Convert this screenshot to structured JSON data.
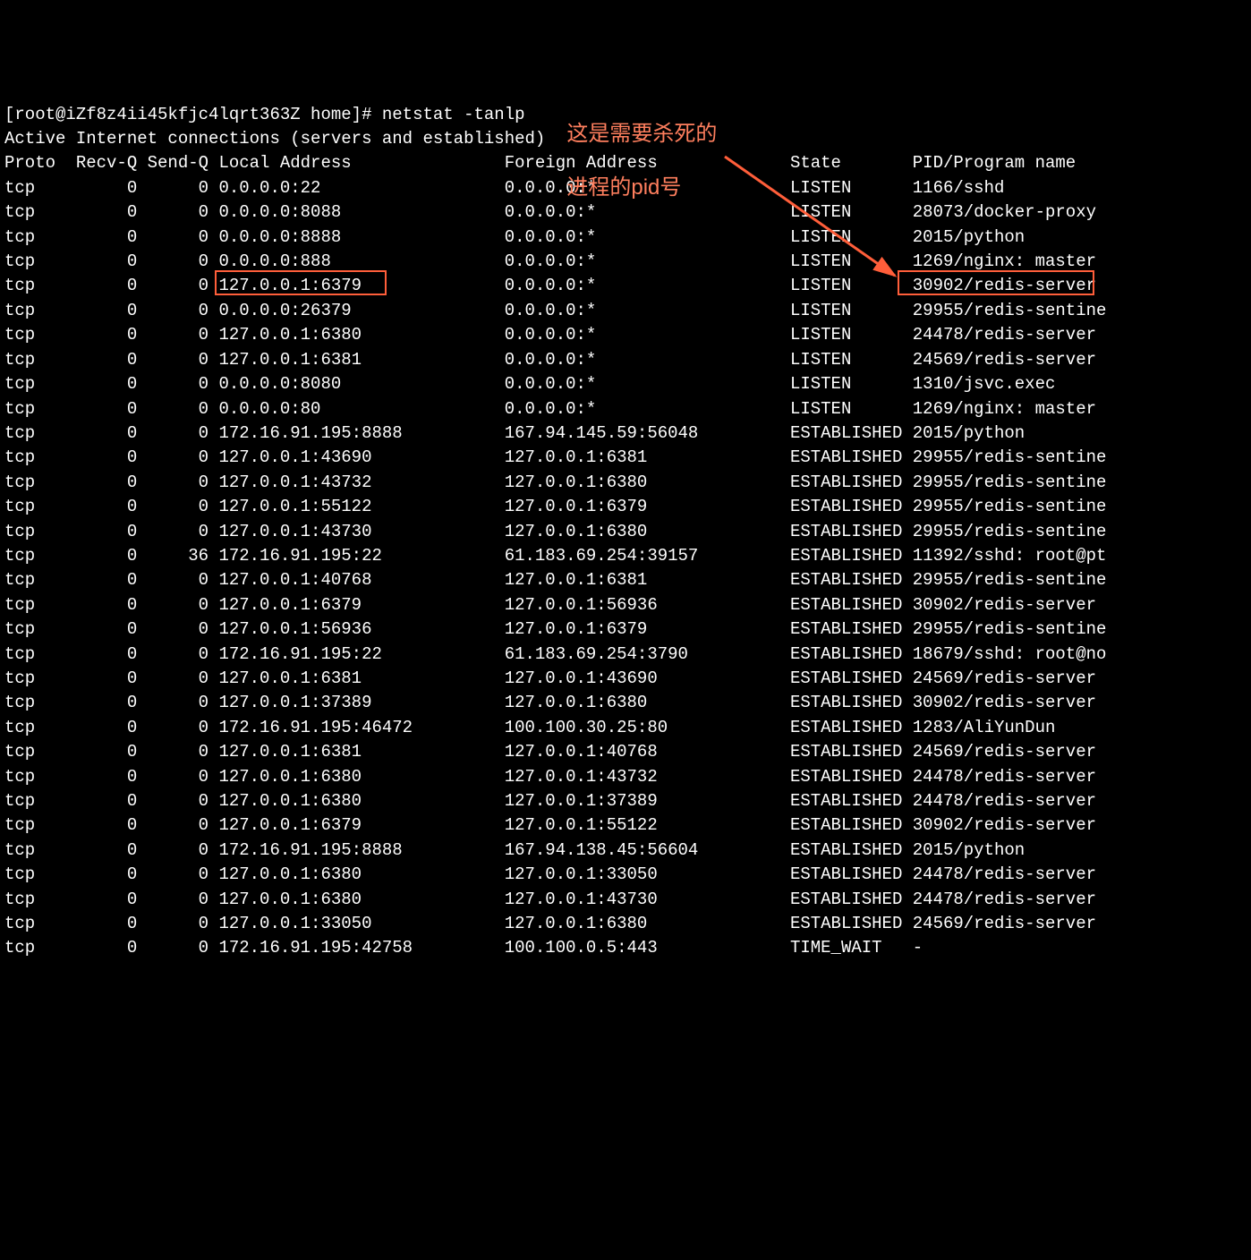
{
  "prompt": "[root@iZf8z4ii45kfjc4lqrt363Z home]# netstat -tanlp",
  "subtitle": "Active Internet connections (servers and established)",
  "header": [
    "Proto",
    "Recv-Q",
    "Send-Q",
    "Local Address",
    "Foreign Address",
    "State",
    "PID/Program name"
  ],
  "rows": [
    {
      "proto": "tcp",
      "recvq": "0",
      "sendq": "0",
      "local": "0.0.0.0:22",
      "foreign": "0.0.0.0:*",
      "state": "LISTEN",
      "pid": "1166/sshd"
    },
    {
      "proto": "tcp",
      "recvq": "0",
      "sendq": "0",
      "local": "0.0.0.0:8088",
      "foreign": "0.0.0.0:*",
      "state": "LISTEN",
      "pid": "28073/docker-proxy"
    },
    {
      "proto": "tcp",
      "recvq": "0",
      "sendq": "0",
      "local": "0.0.0.0:8888",
      "foreign": "0.0.0.0:*",
      "state": "LISTEN",
      "pid": "2015/python"
    },
    {
      "proto": "tcp",
      "recvq": "0",
      "sendq": "0",
      "local": "0.0.0.0:888",
      "foreign": "0.0.0.0:*",
      "state": "LISTEN",
      "pid": "1269/nginx: master"
    },
    {
      "proto": "tcp",
      "recvq": "0",
      "sendq": "0",
      "local": "127.0.0.1:6379",
      "foreign": "0.0.0.0:*",
      "state": "LISTEN",
      "pid": "30902/redis-server"
    },
    {
      "proto": "tcp",
      "recvq": "0",
      "sendq": "0",
      "local": "0.0.0.0:26379",
      "foreign": "0.0.0.0:*",
      "state": "LISTEN",
      "pid": "29955/redis-sentine"
    },
    {
      "proto": "tcp",
      "recvq": "0",
      "sendq": "0",
      "local": "127.0.0.1:6380",
      "foreign": "0.0.0.0:*",
      "state": "LISTEN",
      "pid": "24478/redis-server"
    },
    {
      "proto": "tcp",
      "recvq": "0",
      "sendq": "0",
      "local": "127.0.0.1:6381",
      "foreign": "0.0.0.0:*",
      "state": "LISTEN",
      "pid": "24569/redis-server"
    },
    {
      "proto": "tcp",
      "recvq": "0",
      "sendq": "0",
      "local": "0.0.0.0:8080",
      "foreign": "0.0.0.0:*",
      "state": "LISTEN",
      "pid": "1310/jsvc.exec"
    },
    {
      "proto": "tcp",
      "recvq": "0",
      "sendq": "0",
      "local": "0.0.0.0:80",
      "foreign": "0.0.0.0:*",
      "state": "LISTEN",
      "pid": "1269/nginx: master"
    },
    {
      "proto": "tcp",
      "recvq": "0",
      "sendq": "0",
      "local": "172.16.91.195:8888",
      "foreign": "167.94.145.59:56048",
      "state": "ESTABLISHED",
      "pid": "2015/python"
    },
    {
      "proto": "tcp",
      "recvq": "0",
      "sendq": "0",
      "local": "127.0.0.1:43690",
      "foreign": "127.0.0.1:6381",
      "state": "ESTABLISHED",
      "pid": "29955/redis-sentine"
    },
    {
      "proto": "tcp",
      "recvq": "0",
      "sendq": "0",
      "local": "127.0.0.1:43732",
      "foreign": "127.0.0.1:6380",
      "state": "ESTABLISHED",
      "pid": "29955/redis-sentine"
    },
    {
      "proto": "tcp",
      "recvq": "0",
      "sendq": "0",
      "local": "127.0.0.1:55122",
      "foreign": "127.0.0.1:6379",
      "state": "ESTABLISHED",
      "pid": "29955/redis-sentine"
    },
    {
      "proto": "tcp",
      "recvq": "0",
      "sendq": "0",
      "local": "127.0.0.1:43730",
      "foreign": "127.0.0.1:6380",
      "state": "ESTABLISHED",
      "pid": "29955/redis-sentine"
    },
    {
      "proto": "tcp",
      "recvq": "0",
      "sendq": "36",
      "local": "172.16.91.195:22",
      "foreign": "61.183.69.254:39157",
      "state": "ESTABLISHED",
      "pid": "11392/sshd: root@pt"
    },
    {
      "proto": "tcp",
      "recvq": "0",
      "sendq": "0",
      "local": "127.0.0.1:40768",
      "foreign": "127.0.0.1:6381",
      "state": "ESTABLISHED",
      "pid": "29955/redis-sentine"
    },
    {
      "proto": "tcp",
      "recvq": "0",
      "sendq": "0",
      "local": "127.0.0.1:6379",
      "foreign": "127.0.0.1:56936",
      "state": "ESTABLISHED",
      "pid": "30902/redis-server"
    },
    {
      "proto": "tcp",
      "recvq": "0",
      "sendq": "0",
      "local": "127.0.0.1:56936",
      "foreign": "127.0.0.1:6379",
      "state": "ESTABLISHED",
      "pid": "29955/redis-sentine"
    },
    {
      "proto": "tcp",
      "recvq": "0",
      "sendq": "0",
      "local": "172.16.91.195:22",
      "foreign": "61.183.69.254:3790",
      "state": "ESTABLISHED",
      "pid": "18679/sshd: root@no"
    },
    {
      "proto": "tcp",
      "recvq": "0",
      "sendq": "0",
      "local": "127.0.0.1:6381",
      "foreign": "127.0.0.1:43690",
      "state": "ESTABLISHED",
      "pid": "24569/redis-server"
    },
    {
      "proto": "tcp",
      "recvq": "0",
      "sendq": "0",
      "local": "127.0.0.1:37389",
      "foreign": "127.0.0.1:6380",
      "state": "ESTABLISHED",
      "pid": "30902/redis-server"
    },
    {
      "proto": "tcp",
      "recvq": "0",
      "sendq": "0",
      "local": "172.16.91.195:46472",
      "foreign": "100.100.30.25:80",
      "state": "ESTABLISHED",
      "pid": "1283/AliYunDun"
    },
    {
      "proto": "tcp",
      "recvq": "0",
      "sendq": "0",
      "local": "127.0.0.1:6381",
      "foreign": "127.0.0.1:40768",
      "state": "ESTABLISHED",
      "pid": "24569/redis-server"
    },
    {
      "proto": "tcp",
      "recvq": "0",
      "sendq": "0",
      "local": "127.0.0.1:6380",
      "foreign": "127.0.0.1:43732",
      "state": "ESTABLISHED",
      "pid": "24478/redis-server"
    },
    {
      "proto": "tcp",
      "recvq": "0",
      "sendq": "0",
      "local": "127.0.0.1:6380",
      "foreign": "127.0.0.1:37389",
      "state": "ESTABLISHED",
      "pid": "24478/redis-server"
    },
    {
      "proto": "tcp",
      "recvq": "0",
      "sendq": "0",
      "local": "127.0.0.1:6379",
      "foreign": "127.0.0.1:55122",
      "state": "ESTABLISHED",
      "pid": "30902/redis-server"
    },
    {
      "proto": "tcp",
      "recvq": "0",
      "sendq": "0",
      "local": "172.16.91.195:8888",
      "foreign": "167.94.138.45:56604",
      "state": "ESTABLISHED",
      "pid": "2015/python"
    },
    {
      "proto": "tcp",
      "recvq": "0",
      "sendq": "0",
      "local": "127.0.0.1:6380",
      "foreign": "127.0.0.1:33050",
      "state": "ESTABLISHED",
      "pid": "24478/redis-server"
    },
    {
      "proto": "tcp",
      "recvq": "0",
      "sendq": "0",
      "local": "127.0.0.1:6380",
      "foreign": "127.0.0.1:43730",
      "state": "ESTABLISHED",
      "pid": "24478/redis-server"
    },
    {
      "proto": "tcp",
      "recvq": "0",
      "sendq": "0",
      "local": "127.0.0.1:33050",
      "foreign": "127.0.0.1:6380",
      "state": "ESTABLISHED",
      "pid": "24569/redis-server"
    },
    {
      "proto": "tcp",
      "recvq": "0",
      "sendq": "0",
      "local": "172.16.91.195:42758",
      "foreign": "100.100.0.5:443",
      "state": "TIME_WAIT",
      "pid": "-"
    }
  ],
  "annotation": {
    "line1": "这是需要杀死的",
    "line2": "进程的pid号"
  },
  "cols": {
    "proto": 0,
    "recvq": 7,
    "sendq": 14,
    "local": 21,
    "foreign": 49,
    "state": 77,
    "pid": 89
  },
  "widths": {
    "recvq": 6,
    "sendq": 6
  }
}
